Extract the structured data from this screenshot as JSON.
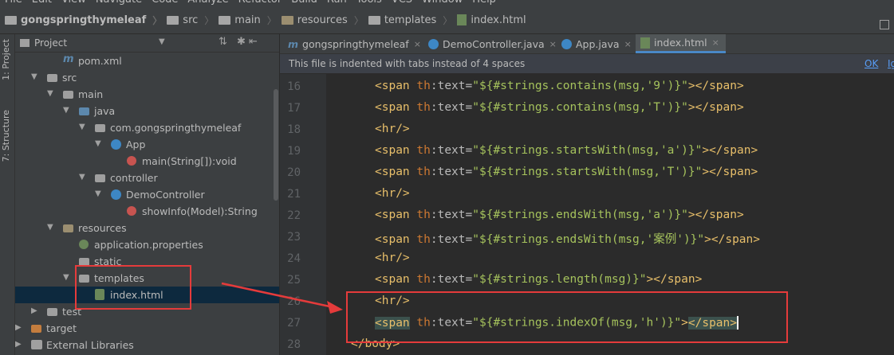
{
  "menu": [
    "File",
    "Edit",
    "View",
    "Navigate",
    "Code",
    "Analyze",
    "Refactor",
    "Build",
    "Run",
    "Tools",
    "VCS",
    "Window",
    "Help"
  ],
  "breadcrumb": [
    "gongspringthymeleaf",
    "src",
    "main",
    "resources",
    "templates",
    "index.html"
  ],
  "toolstrip": {
    "project_tab": "1: Project",
    "structure_tab": "7: Structure"
  },
  "project_panel": {
    "title": "Project"
  },
  "tree": [
    {
      "label": "pom.xml",
      "icon": "maven-m-icon"
    },
    {
      "label": "src",
      "icon": "folder-icon"
    },
    {
      "label": "main",
      "icon": "folder-icon"
    },
    {
      "label": "java",
      "icon": "source-folder-icon"
    },
    {
      "label": "com.gongspringthymeleaf",
      "icon": "package-icon"
    },
    {
      "label": "App",
      "icon": "class-icon"
    },
    {
      "label": "main(String[]):void",
      "icon": "method-icon"
    },
    {
      "label": "controller",
      "icon": "package-icon"
    },
    {
      "label": "DemoController",
      "icon": "class-icon"
    },
    {
      "label": "showInfo(Model):String",
      "icon": "method-icon"
    },
    {
      "label": "resources",
      "icon": "resources-folder-icon"
    },
    {
      "label": "application.properties",
      "icon": "properties-icon"
    },
    {
      "label": "static",
      "icon": "folder-icon"
    },
    {
      "label": "templates",
      "icon": "folder-icon"
    },
    {
      "label": "index.html",
      "icon": "html-file-icon"
    },
    {
      "label": "test",
      "icon": "folder-icon"
    },
    {
      "label": "target",
      "icon": "target-folder-icon"
    },
    {
      "label": "External Libraries",
      "icon": "library-icon"
    }
  ],
  "tabs": [
    {
      "label": "gongspringthymeleaf",
      "icon": "maven-m-icon"
    },
    {
      "label": "DemoController.java",
      "icon": "class-icon"
    },
    {
      "label": "App.java",
      "icon": "class-icon"
    },
    {
      "label": "index.html",
      "icon": "html-file-icon"
    }
  ],
  "notice": {
    "message": "This file is indented with tabs instead of 4 spaces",
    "ok": "OK",
    "ignore": "Ig"
  },
  "code": [
    {
      "n": "16",
      "parts": [
        [
          "tag",
          "<span "
        ],
        [
          "ns",
          "th"
        ],
        [
          "attr",
          ":text="
        ],
        [
          "val",
          "\"${#strings.contains(msg,'9')}\""
        ],
        [
          "tag",
          "></span>"
        ]
      ]
    },
    {
      "n": "17",
      "parts": [
        [
          "tag",
          "<span "
        ],
        [
          "ns",
          "th"
        ],
        [
          "attr",
          ":text="
        ],
        [
          "val",
          "\"${#strings.contains(msg,'T')}\""
        ],
        [
          "tag",
          "></span>"
        ]
      ]
    },
    {
      "n": "18",
      "parts": [
        [
          "tag",
          "<hr/>"
        ]
      ]
    },
    {
      "n": "19",
      "parts": [
        [
          "tag",
          "<span "
        ],
        [
          "ns",
          "th"
        ],
        [
          "attr",
          ":text="
        ],
        [
          "val",
          "\"${#strings.startsWith(msg,'a')}\""
        ],
        [
          "tag",
          "></span>"
        ]
      ]
    },
    {
      "n": "20",
      "parts": [
        [
          "tag",
          "<span "
        ],
        [
          "ns",
          "th"
        ],
        [
          "attr",
          ":text="
        ],
        [
          "val",
          "\"${#strings.startsWith(msg,'T')}\""
        ],
        [
          "tag",
          "></span>"
        ]
      ]
    },
    {
      "n": "21",
      "parts": [
        [
          "tag",
          "<hr/>"
        ]
      ]
    },
    {
      "n": "22",
      "parts": [
        [
          "tag",
          "<span "
        ],
        [
          "ns",
          "th"
        ],
        [
          "attr",
          ":text="
        ],
        [
          "val",
          "\"${#strings.endsWith(msg,'a')}\""
        ],
        [
          "tag",
          "></span>"
        ]
      ]
    },
    {
      "n": "23",
      "parts": [
        [
          "tag",
          "<span "
        ],
        [
          "ns",
          "th"
        ],
        [
          "attr",
          ":text="
        ],
        [
          "val",
          "\"${#strings.endsWith(msg,'案例')}\""
        ],
        [
          "tag",
          "></span>"
        ]
      ]
    },
    {
      "n": "24",
      "parts": [
        [
          "tag",
          "<hr/>"
        ]
      ]
    },
    {
      "n": "25",
      "parts": [
        [
          "tag",
          "<span "
        ],
        [
          "ns",
          "th"
        ],
        [
          "attr",
          ":text="
        ],
        [
          "val",
          "\"${#strings.length(msg)}\""
        ],
        [
          "tag",
          "></span>"
        ]
      ]
    },
    {
      "n": "26",
      "parts": [
        [
          "tag",
          "<hr/>"
        ]
      ]
    },
    {
      "n": "27",
      "parts": [
        [
          "tag",
          "<span"
        ],
        [
          "tag",
          " "
        ],
        [
          "ns",
          "th"
        ],
        [
          "attr",
          ":text="
        ],
        [
          "val",
          "\"${#strings.indexOf(msg,'h')}\""
        ],
        [
          "tag",
          ">"
        ],
        [
          "tag",
          "</span>"
        ]
      ]
    },
    {
      "n": "28",
      "parts": [
        [
          "tag",
          "</body>"
        ]
      ]
    }
  ],
  "colors": {
    "annotation": "#e53b3b",
    "accent": "#4a88c7"
  }
}
